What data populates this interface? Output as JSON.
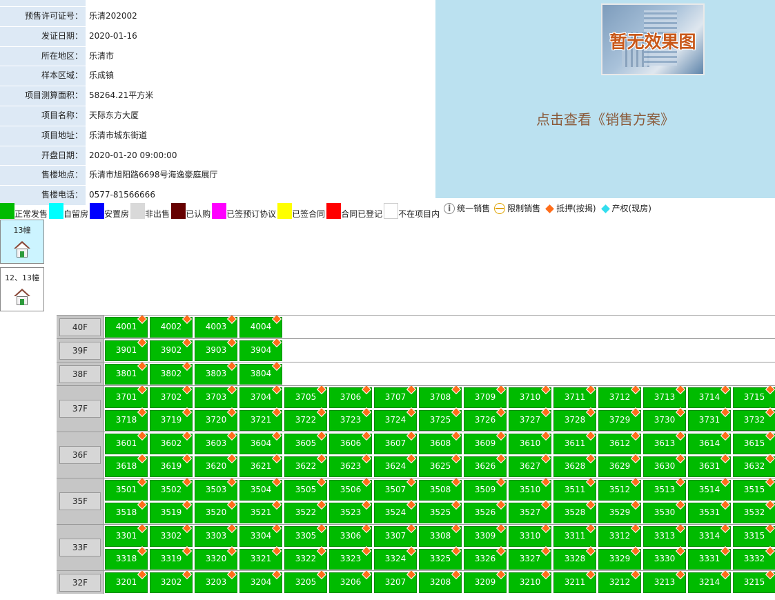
{
  "info": [
    {
      "label": "",
      "value": "",
      "partial": true
    },
    {
      "label": "预售许可证号：",
      "value": "乐清202002"
    },
    {
      "label": "发证日期：",
      "value": "2020-01-16"
    },
    {
      "label": "所在地区：",
      "value": "乐清市"
    },
    {
      "label": "样本区域：",
      "value": "乐成镇"
    },
    {
      "label": "项目测算面积：",
      "value": "58264.21平方米"
    },
    {
      "label": "项目名称：",
      "value": "天际东方大厦"
    },
    {
      "label": "项目地址：",
      "value": "乐清市城东街道"
    },
    {
      "label": "开盘日期：",
      "value": "2020-01-20 09:00:00"
    },
    {
      "label": "售楼地点：",
      "value": "乐清市旭阳路6698号海逸豪庭展厅"
    },
    {
      "label": "售楼电话：",
      "value": "0577-81566666"
    }
  ],
  "promo": {
    "image_caption": "暂无效果图",
    "sales_plan_link": "点击查看《销售方案》"
  },
  "legend": [
    {
      "label": "正常发售",
      "color": "#00bb00"
    },
    {
      "label": "自留房",
      "color": "#00ffff"
    },
    {
      "label": "安置房",
      "color": "#0000ff"
    },
    {
      "label": "非出售",
      "color": "#d9d9d9"
    },
    {
      "label": "已认购",
      "color": "#660000"
    },
    {
      "label": "已签预订协议",
      "color": "#ff00ff"
    },
    {
      "label": "已签合同",
      "color": "#ffff00"
    },
    {
      "label": "合同已登记",
      "color": "#ff0000"
    },
    {
      "label": "不在项目内",
      "color": "#ffffff"
    }
  ],
  "legend_symbols": [
    {
      "label": "统一销售",
      "icon": "info-circle-icon"
    },
    {
      "label": "限制销售",
      "icon": "restricted-circle-icon"
    },
    {
      "label": "抵押(按揭)",
      "icon": "orange-diamond-icon",
      "color": "#ff6d1a"
    },
    {
      "label": "产权(现房)",
      "icon": "cyan-diamond-icon",
      "color": "#33ddee"
    }
  ],
  "buildings": [
    {
      "label": "13幢",
      "active": true
    },
    {
      "label": "12、13幢",
      "active": false
    }
  ],
  "floors": [
    {
      "label": "40F",
      "rows": [
        [
          "4001",
          "4002",
          "4003",
          "4004"
        ]
      ]
    },
    {
      "label": "39F",
      "rows": [
        [
          "3901",
          "3902",
          "3903",
          "3904"
        ]
      ]
    },
    {
      "label": "38F",
      "rows": [
        [
          "3801",
          "3802",
          "3803",
          "3804"
        ]
      ]
    },
    {
      "label": "37F",
      "rows": [
        [
          "3701",
          "3702",
          "3703",
          "3704",
          "3705",
          "3706",
          "3707",
          "3708",
          "3709",
          "3710",
          "3711",
          "3712",
          "3713",
          "3714",
          "3715"
        ],
        [
          "3718",
          "3719",
          "3720",
          "3721",
          "3722",
          "3723",
          "3724",
          "3725",
          "3726",
          "3727",
          "3728",
          "3729",
          "3730",
          "3731",
          "3732"
        ]
      ]
    },
    {
      "label": "36F",
      "rows": [
        [
          "3601",
          "3602",
          "3603",
          "3604",
          "3605",
          "3606",
          "3607",
          "3608",
          "3609",
          "3610",
          "3611",
          "3612",
          "3613",
          "3614",
          "3615"
        ],
        [
          "3618",
          "3619",
          "3620",
          "3621",
          "3622",
          "3623",
          "3624",
          "3625",
          "3626",
          "3627",
          "3628",
          "3629",
          "3630",
          "3631",
          "3632"
        ]
      ]
    },
    {
      "label": "35F",
      "rows": [
        [
          "3501",
          "3502",
          "3503",
          "3504",
          "3505",
          "3506",
          "3507",
          "3508",
          "3509",
          "3510",
          "3511",
          "3512",
          "3513",
          "3514",
          "3515"
        ],
        [
          "3518",
          "3519",
          "3520",
          "3521",
          "3522",
          "3523",
          "3524",
          "3525",
          "3526",
          "3527",
          "3528",
          "3529",
          "3530",
          "3531",
          "3532"
        ]
      ]
    },
    {
      "label": "33F",
      "rows": [
        [
          "3301",
          "3302",
          "3303",
          "3304",
          "3305",
          "3306",
          "3307",
          "3308",
          "3309",
          "3310",
          "3311",
          "3312",
          "3313",
          "3314",
          "3315"
        ],
        [
          "3318",
          "3319",
          "3320",
          "3321",
          "3322",
          "3323",
          "3324",
          "3325",
          "3326",
          "3327",
          "3328",
          "3329",
          "3330",
          "3331",
          "3332"
        ]
      ]
    },
    {
      "label": "32F",
      "rows": [
        [
          "3201",
          "3202",
          "3203",
          "3204",
          "3205",
          "3206",
          "3207",
          "3208",
          "3209",
          "3210",
          "3211",
          "3212",
          "3213",
          "3214",
          "3215"
        ]
      ]
    }
  ]
}
